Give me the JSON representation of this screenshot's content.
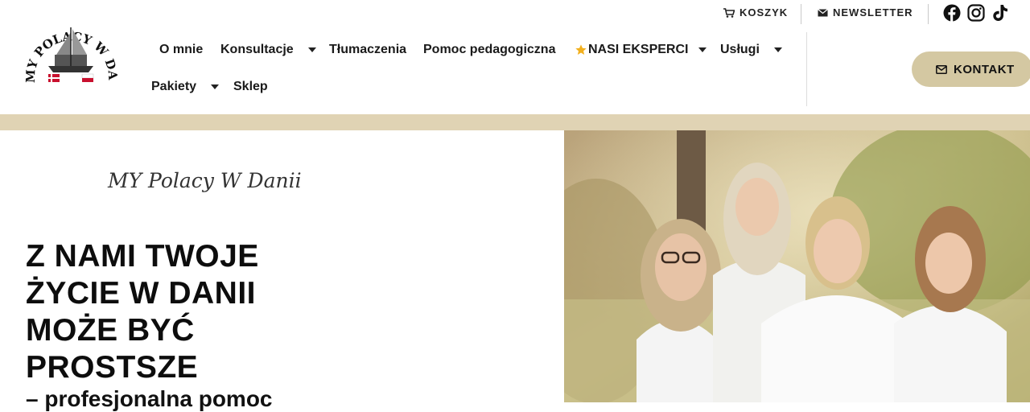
{
  "logo": {
    "text": "MY POLACY W DANII"
  },
  "top_util": {
    "cart": {
      "label": "KOSZYK",
      "icon": "cart-icon"
    },
    "newsletter": {
      "label": "NEWSLETTER",
      "icon": "envelope-icon"
    },
    "social": [
      "facebook-icon",
      "instagram-icon",
      "tiktok-icon"
    ]
  },
  "nav": {
    "items": [
      {
        "label": "O mnie"
      },
      {
        "label": "Konsultacje"
      },
      {
        "label": "Tłumaczenia"
      },
      {
        "label": "Pomoc pedagogiczna"
      },
      {
        "label": "NASI EKSPERCI"
      },
      {
        "label": "Usługi"
      },
      {
        "label": "Pakiety"
      },
      {
        "label": "Sklep"
      }
    ]
  },
  "cta": {
    "label": "KONTAKT",
    "icon": "envelope-icon"
  },
  "hero": {
    "tagline": "MY Polacy W Danii",
    "headline_lines": [
      "Z NAMI TWOJE",
      "ŻYCIE W DANII",
      "MOŻE BYĆ",
      "PROSTSZE"
    ],
    "subline": "– profesjonalna pomoc"
  },
  "colors": {
    "accent": "#d4c8a2",
    "band": "#e0d3b4",
    "star": "#f2b01e"
  }
}
